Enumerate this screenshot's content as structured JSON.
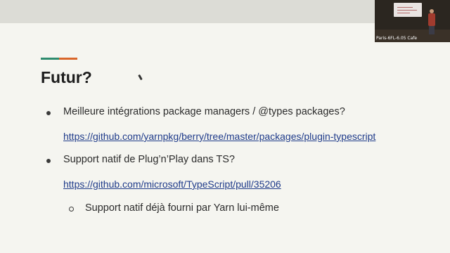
{
  "slide": {
    "title": "Futur?",
    "accent_colors": {
      "left": "#2e8b6e",
      "right": "#d9662a"
    },
    "items": [
      {
        "text": "Meilleure intégrations package managers / @types packages?",
        "link": "https://github.com/yarnpkg/berry/tree/master/packages/plugin-typescript"
      },
      {
        "text": "Support natif de Plug’n’Play dans TS?",
        "link": "https://github.com/microsoft/TypeScript/pull/35206",
        "subitems": [
          {
            "text": "Support natif déjà fourni par Yarn lui-même"
          }
        ]
      }
    ]
  },
  "webcam": {
    "label": "Paris-6FL-6.05 Cafe"
  }
}
